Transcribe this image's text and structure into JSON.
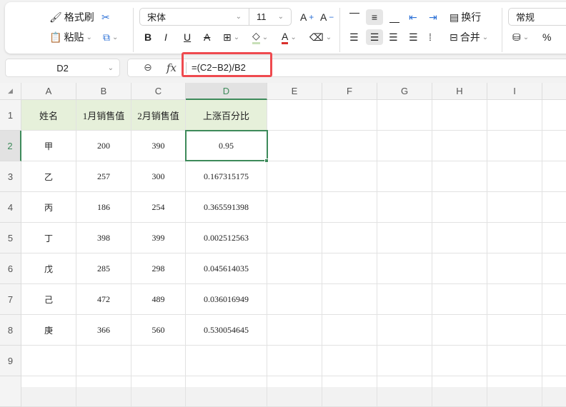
{
  "toolbar": {
    "format_painter": "格式刷",
    "paste": "粘贴",
    "font": "宋体",
    "size": "11",
    "wrap": "换行",
    "merge": "合并",
    "number_format": "常规",
    "percent": "%",
    "icons": [
      "format-painter-icon",
      "cut-icon",
      "paste-icon",
      "copy-icon",
      "bold-icon",
      "italic-icon",
      "underline-icon",
      "strikethrough-icon",
      "border-icon",
      "fill-color-icon",
      "font-color-icon",
      "eraser-icon",
      "increase-font-icon",
      "decrease-font-icon",
      "align-top-icon",
      "align-middle-icon",
      "align-bottom-icon",
      "outdent-icon",
      "indent-icon",
      "align-left-icon",
      "align-center-icon",
      "align-right-icon",
      "justify-icon",
      "distributed-icon",
      "wrap-icon",
      "merge-icon",
      "database-icon"
    ]
  },
  "formula_bar": {
    "name_box": "D2",
    "fx": "fx",
    "formula": "=(C2−B2)/B2"
  },
  "columns": [
    "A",
    "B",
    "C",
    "D",
    "E",
    "F",
    "G",
    "H",
    "I"
  ],
  "rows": [
    "1",
    "2",
    "3",
    "4",
    "5",
    "6",
    "7",
    "8",
    "9"
  ],
  "table": {
    "headers": [
      "姓名",
      "1月销售值",
      "2月销售值",
      "上涨百分比"
    ],
    "rows": [
      [
        "甲",
        "200",
        "390",
        "0.95"
      ],
      [
        "乙",
        "257",
        "300",
        "0.167315175"
      ],
      [
        "丙",
        "186",
        "254",
        "0.365591398"
      ],
      [
        "丁",
        "398",
        "399",
        "0.002512563"
      ],
      [
        "戊",
        "285",
        "298",
        "0.045614035"
      ],
      [
        "己",
        "472",
        "489",
        "0.036016949"
      ],
      [
        "庚",
        "366",
        "560",
        "0.530054645"
      ]
    ]
  },
  "colors": {
    "accent": "#3d8a5a",
    "header_fill": "#e6f0da",
    "highlight": "#ef4a4f",
    "font_color_bar": "#d9302c"
  }
}
